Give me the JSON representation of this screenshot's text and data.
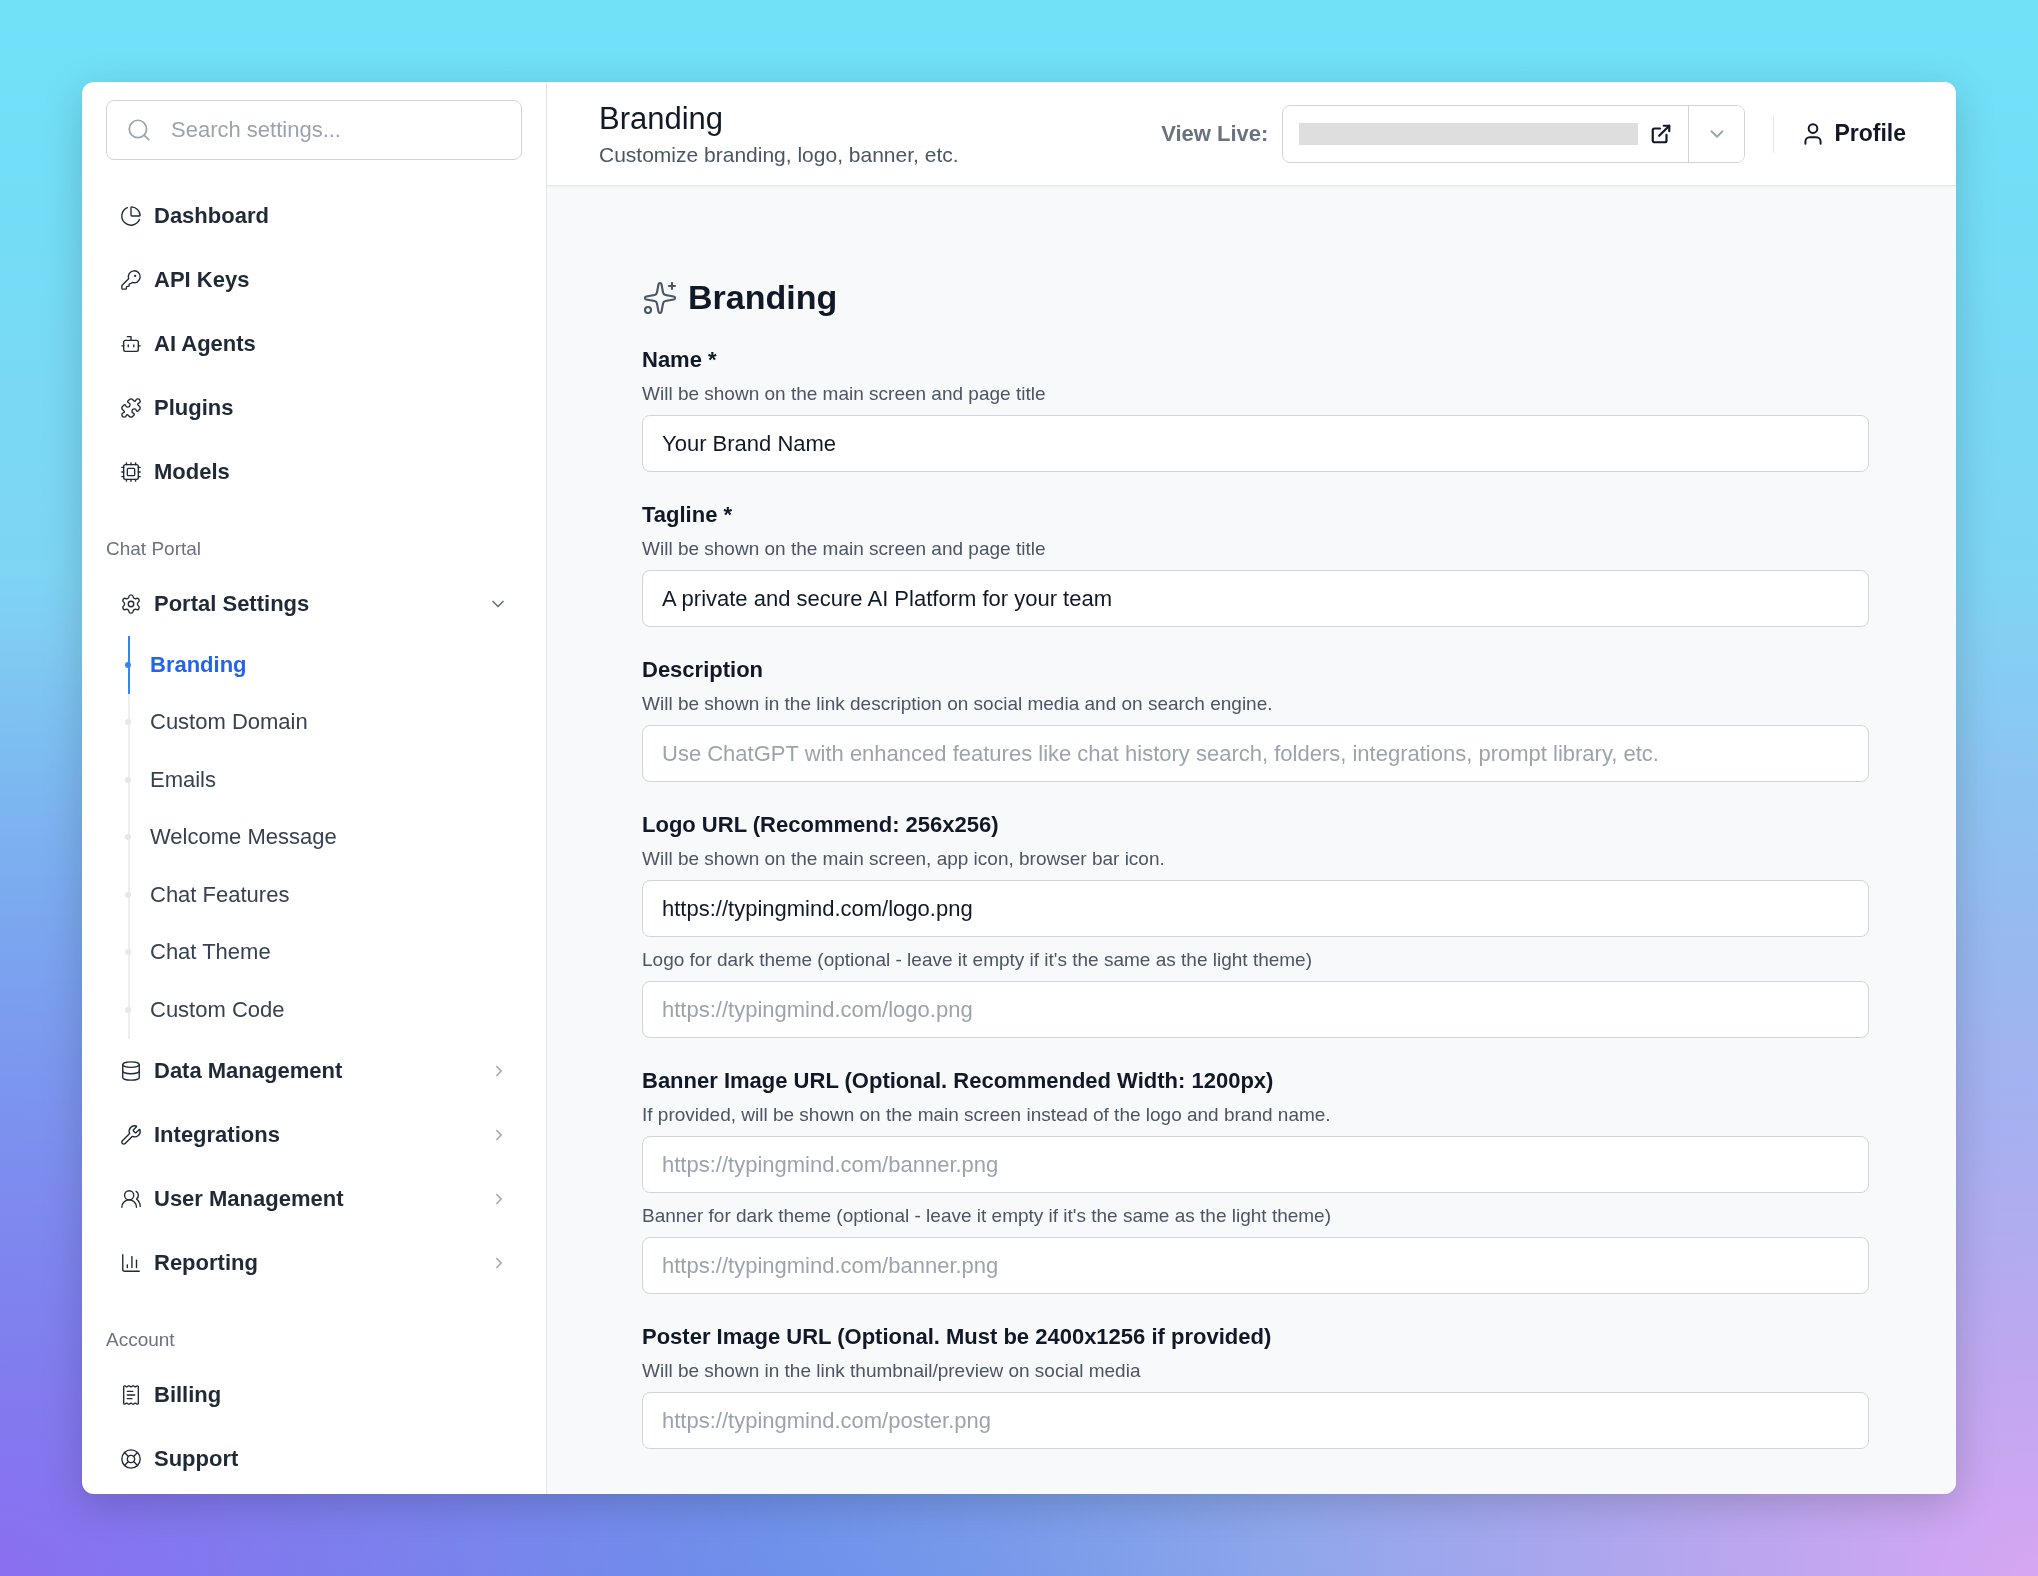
{
  "sidebar": {
    "search": {
      "placeholder": "Search settings..."
    },
    "groups": [
      {
        "items": [
          {
            "label": "Dashboard",
            "selected": false
          },
          {
            "label": "API Keys",
            "selected": false
          },
          {
            "label": "AI Agents",
            "selected": false
          },
          {
            "label": "Plugins",
            "selected": false
          },
          {
            "label": "Models",
            "selected": false
          }
        ]
      },
      {
        "title": "Chat Portal",
        "items": [
          {
            "label": "Portal Settings",
            "selected": false,
            "expanded": true,
            "children": [
              {
                "label": "Branding",
                "selected": true
              },
              {
                "label": "Custom Domain",
                "selected": false
              },
              {
                "label": "Emails",
                "selected": false
              },
              {
                "label": "Welcome Message",
                "selected": false
              },
              {
                "label": "Chat Features",
                "selected": false
              },
              {
                "label": "Chat Theme",
                "selected": false
              },
              {
                "label": "Custom Code",
                "selected": false
              }
            ]
          },
          {
            "label": "Data Management",
            "selected": false,
            "expanded": false
          },
          {
            "label": "Integrations",
            "selected": false,
            "expanded": false
          },
          {
            "label": "User Management",
            "selected": false,
            "expanded": false
          },
          {
            "label": "Reporting",
            "selected": false,
            "expanded": false
          }
        ]
      },
      {
        "title": "Account",
        "items": [
          {
            "label": "Billing",
            "selected": false
          },
          {
            "label": "Support",
            "selected": false
          }
        ]
      }
    ]
  },
  "header": {
    "title": "Branding",
    "subtitle": "Customize branding, logo, banner, etc.",
    "view_live_label": "View Live:",
    "profile": "Profile"
  },
  "form": {
    "heading": "Branding",
    "fields": [
      {
        "label": "Name *",
        "hint": "Will be shown on the main screen and page title",
        "inputs": [
          {
            "value": "Your Brand Name"
          }
        ]
      },
      {
        "label": "Tagline *",
        "hint": "Will be shown on the main screen and page title",
        "inputs": [
          {
            "value": "A private and secure AI Platform for your team"
          }
        ]
      },
      {
        "label": "Description",
        "hint": "Will be shown in the link description on social media and on search engine.",
        "inputs": [
          {
            "placeholder": "Use ChatGPT with enhanced features like chat history search, folders, integrations, prompt library, etc."
          }
        ]
      },
      {
        "label": "Logo URL (Recommend: 256x256)",
        "hint": "Will be shown on the main screen, app icon, browser bar icon.",
        "inputs": [
          {
            "value": "https://typingmind.com/logo.png"
          },
          {
            "note": "Logo for dark theme (optional - leave it empty if it's the same as the light theme)",
            "placeholder": "https://typingmind.com/logo.png"
          }
        ]
      },
      {
        "label": "Banner Image URL (Optional. Recommended Width: 1200px)",
        "hint": "If provided, will be shown on the main screen instead of the logo and brand name.",
        "inputs": [
          {
            "placeholder": "https://typingmind.com/banner.png"
          },
          {
            "note": "Banner for dark theme (optional - leave it empty if it's the same as the light theme)",
            "placeholder": "https://typingmind.com/banner.png"
          }
        ]
      },
      {
        "label": "Poster Image URL (Optional. Must be 2400x1256 if provided)",
        "hint": "Will be shown in the link thumbnail/preview on social media",
        "inputs": [
          {
            "placeholder": "https://typingmind.com/poster.png"
          }
        ]
      }
    ]
  }
}
